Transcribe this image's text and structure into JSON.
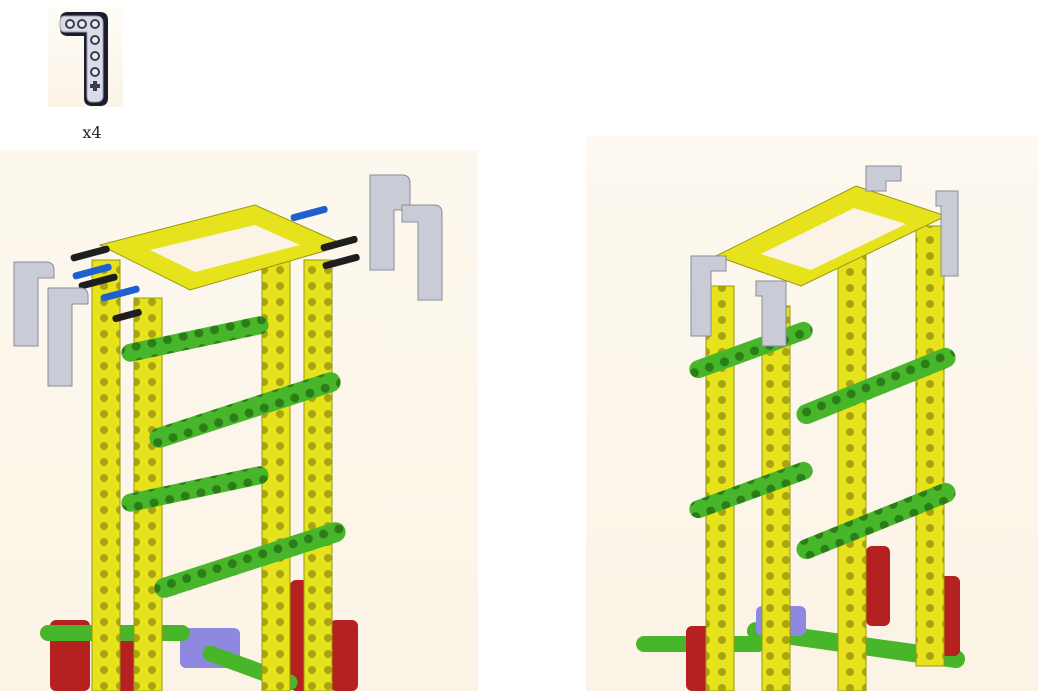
{
  "step": {
    "part_quantity": "x4",
    "part_icon": "lego-l-beam-3x5-icon",
    "colors": {
      "beam_yellow": "#e6e21c",
      "beam_green": "#47b62a",
      "l_beam_gray": "#c9cbd6",
      "pin_black": "#1e1e1e",
      "pin_blue": "#1f5fd0",
      "base_red": "#b52121",
      "base_purple": "#8f88e0"
    }
  }
}
